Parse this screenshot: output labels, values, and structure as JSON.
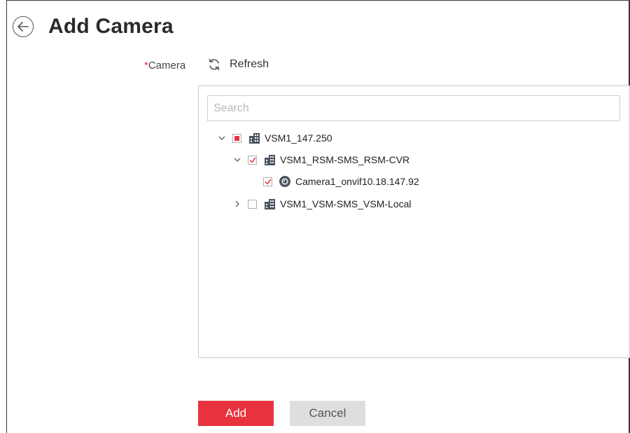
{
  "header": {
    "title": "Add Camera"
  },
  "form": {
    "required_mark": "*",
    "camera_label": "Camera",
    "refresh_label": "Refresh"
  },
  "search": {
    "placeholder": "Search",
    "value": ""
  },
  "tree": [
    {
      "label": "VSM1_147.250",
      "expanded": true,
      "check": "partial",
      "icon": "building-icon"
    },
    {
      "label": "VSM1_RSM-SMS_RSM-CVR",
      "expanded": true,
      "check": "checked",
      "icon": "building-icon"
    },
    {
      "label": "Camera1_onvif10.18.147.92",
      "check": "checked",
      "icon": "camera-icon"
    },
    {
      "label": "VSM1_VSM-SMS_VSM-Local",
      "expanded": false,
      "check": "unchecked",
      "icon": "building-icon"
    }
  ],
  "buttons": {
    "add": "Add",
    "cancel": "Cancel"
  },
  "colors": {
    "accent": "#e8333f",
    "cancel_bg": "#dedede",
    "border": "#c9c9c9"
  }
}
